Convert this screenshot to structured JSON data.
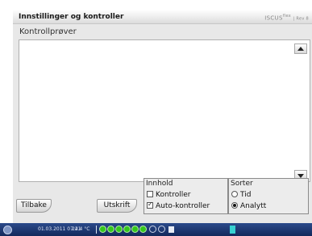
{
  "window": {
    "title": "Innstillinger og kontroller",
    "brand": "ISCUS",
    "brand_sup": "flex",
    "brand_small": "| Rev 8",
    "subtitle": "Kontrollprøver"
  },
  "buttons": {
    "back": "Tilbake",
    "print": "Utskrift"
  },
  "content_group": {
    "title": "Innhold",
    "options": [
      {
        "label": "Kontroller",
        "checked": false
      },
      {
        "label": "Auto-kontroller",
        "checked": true
      }
    ]
  },
  "sort_group": {
    "title": "Sorter",
    "options": [
      {
        "label": "Tid",
        "selected": false
      },
      {
        "label": "Analytt",
        "selected": true
      }
    ]
  },
  "statusbar": {
    "datetime": "01.03.2011 07:21",
    "temperature": "24.4 °C"
  },
  "icons": {
    "scroll_up": "triangle-up-icon",
    "scroll_down": "triangle-down-icon",
    "status_indicators": "green-smiley-icon"
  },
  "colors": {
    "statusbar": "#1e3a78",
    "indicator_green": "#34c61d",
    "flag": "#37d1d1"
  }
}
